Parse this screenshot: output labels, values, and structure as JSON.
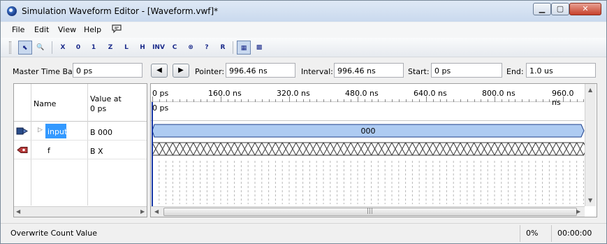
{
  "window": {
    "title": "Simulation Waveform Editor - [Waveform.vwf]*",
    "min_glyph": "▁",
    "max_glyph": "▢",
    "close_glyph": "✕"
  },
  "menu": {
    "file": "File",
    "edit": "Edit",
    "view": "View",
    "help": "Help"
  },
  "toolbar": {
    "tools": [
      {
        "icon": "pointer-icon",
        "glyph": "⬉"
      },
      {
        "icon": "zoom-icon",
        "glyph": "🔍"
      },
      {
        "icon": "force-unknown-icon",
        "glyph": "X"
      },
      {
        "icon": "force-low-icon",
        "glyph": "0"
      },
      {
        "icon": "force-high-icon",
        "glyph": "1"
      },
      {
        "icon": "force-high-impedance-icon",
        "glyph": "Z"
      },
      {
        "icon": "weak-low-icon",
        "glyph": "L"
      },
      {
        "icon": "weak-high-icon",
        "glyph": "H"
      },
      {
        "icon": "invert-icon",
        "glyph": "INV"
      },
      {
        "icon": "count-value-icon",
        "glyph": "C"
      },
      {
        "icon": "clock-icon",
        "glyph": "⊗"
      },
      {
        "icon": "arbitrary-value-icon",
        "glyph": "?"
      },
      {
        "icon": "random-value-icon",
        "glyph": "R"
      },
      {
        "icon": "snap-to-grid-icon",
        "glyph": "▦"
      },
      {
        "icon": "grid-settings-icon",
        "glyph": "▩"
      }
    ]
  },
  "timebar": {
    "master_label": "Master Time Bar:",
    "master_value": "0 ps",
    "pointer_label": "Pointer:",
    "pointer_value": "996.46 ns",
    "interval_label": "Interval:",
    "interval_value": "996.46 ns",
    "start_label": "Start:",
    "start_value": "0 ps",
    "end_label": "End:",
    "end_value": "1.0 us",
    "prev_glyph": "◀",
    "next_glyph": "▶"
  },
  "signals": {
    "col_name": "Name",
    "col_value_line1": "Value at",
    "col_value_line2": "0 ps",
    "rows": [
      {
        "name": "inputs",
        "value": "B 000",
        "icon": "input-pin-icon",
        "selected": true
      },
      {
        "name": "f",
        "value": "B X",
        "icon": "output-pin-icon",
        "selected": false
      }
    ]
  },
  "waveform": {
    "ruler_labels": [
      "0 ps",
      "160.0 ns",
      "320.0 ns",
      "480.0 ns",
      "640.0 ns",
      "800.0 ns",
      "960.0 ns"
    ],
    "cursor_label": "0 ps",
    "bus_value": "000",
    "bus_color": "#aecbf2",
    "unknown_color": "#3a3a3a"
  },
  "status": {
    "text": "Overwrite Count Value",
    "percent": "0%",
    "elapsed": "00:00:00"
  }
}
